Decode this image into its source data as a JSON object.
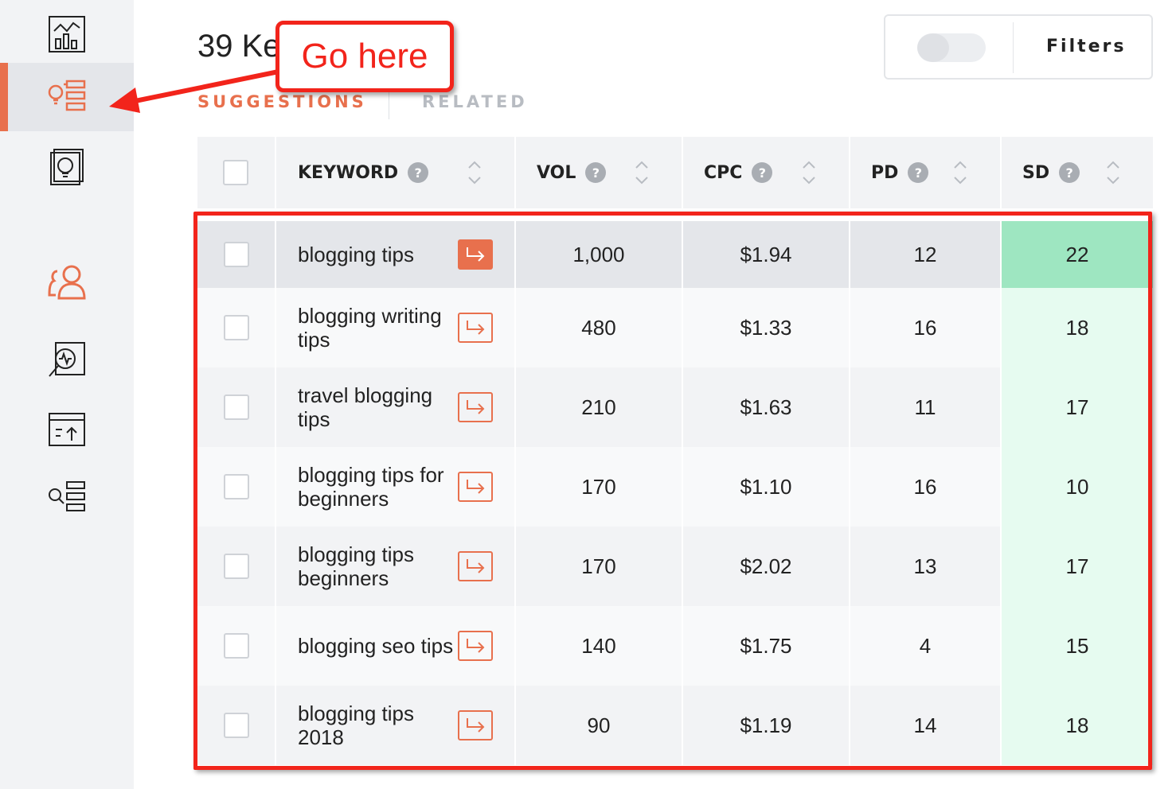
{
  "header": {
    "title": "39 Ke",
    "tabs": {
      "suggestions": "SUGGESTIONS",
      "related": "RELATED"
    },
    "filters_label": "Filters"
  },
  "sidebar": {
    "items": [
      {
        "icon": "chart-icon",
        "active": false
      },
      {
        "icon": "keyword-ideas-icon",
        "active": true
      },
      {
        "icon": "content-ideas-icon",
        "active": false
      },
      {
        "icon": "users-icon",
        "active": false
      },
      {
        "icon": "site-audit-icon",
        "active": false
      },
      {
        "icon": "rank-tracking-icon",
        "active": false
      },
      {
        "icon": "keyword-lists-icon",
        "active": false
      }
    ]
  },
  "table": {
    "columns": {
      "keyword": "KEYWORD",
      "vol": "VOL",
      "cpc": "CPC",
      "pd": "PD",
      "sd": "SD"
    },
    "help_glyph": "?",
    "rows": [
      {
        "keyword": "blogging tips",
        "vol": "1,000",
        "cpc": "$1.94",
        "pd": "12",
        "sd": "22"
      },
      {
        "keyword": "blogging writing tips",
        "vol": "480",
        "cpc": "$1.33",
        "pd": "16",
        "sd": "18"
      },
      {
        "keyword": "travel blogging tips",
        "vol": "210",
        "cpc": "$1.63",
        "pd": "11",
        "sd": "17"
      },
      {
        "keyword": "blogging tips for beginners",
        "vol": "170",
        "cpc": "$1.10",
        "pd": "16",
        "sd": "10"
      },
      {
        "keyword": "blogging tips beginners",
        "vol": "170",
        "cpc": "$2.02",
        "pd": "13",
        "sd": "17"
      },
      {
        "keyword": "blogging seo tips",
        "vol": "140",
        "cpc": "$1.75",
        "pd": "4",
        "sd": "15"
      },
      {
        "keyword": "blogging tips 2018",
        "vol": "90",
        "cpc": "$1.19",
        "pd": "14",
        "sd": "18"
      }
    ]
  },
  "annotation": {
    "callout_text": "Go here"
  },
  "colors": {
    "accent": "#e8704d",
    "annotation_red": "#f2241b",
    "sd_high": "#9ee6c1",
    "sd_low": "#e6fbf0"
  }
}
